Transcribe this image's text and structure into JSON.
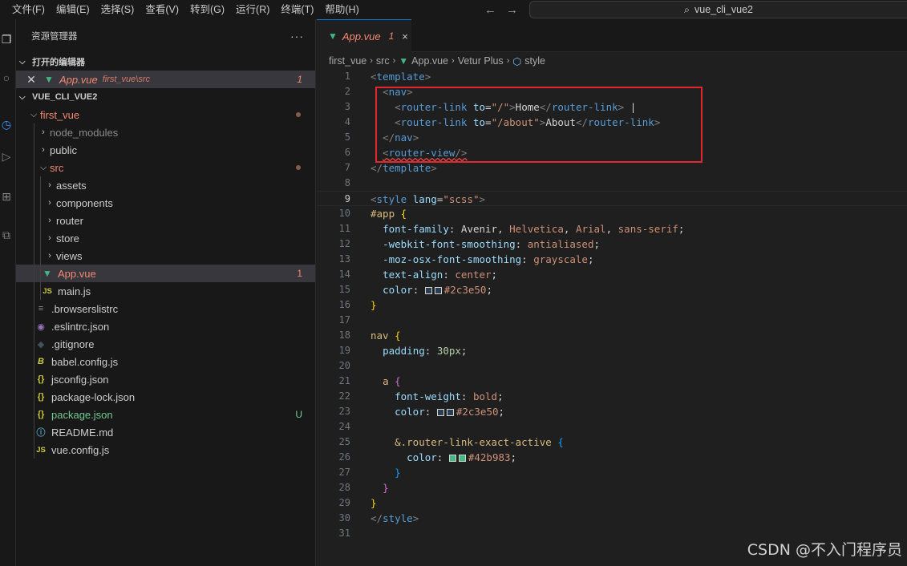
{
  "menu": [
    "文件(F)",
    "编辑(E)",
    "选择(S)",
    "查看(V)",
    "转到(G)",
    "运行(R)",
    "终端(T)",
    "帮助(H)"
  ],
  "search": {
    "text": "vue_cli_vue2"
  },
  "sidebar": {
    "title": "资源管理器",
    "open_editors_title": "打开的编辑器",
    "open_editor": {
      "name": "App.vue",
      "path": "first_vue\\src",
      "problems": "1"
    },
    "project_title": "VUE_CLI_VUE2",
    "tree": [
      {
        "label": "first_vue",
        "status": "modified-dot"
      },
      {
        "label": "node_modules"
      },
      {
        "label": "public"
      },
      {
        "label": "src",
        "status": "modified-dot"
      },
      {
        "label": "assets"
      },
      {
        "label": "components"
      },
      {
        "label": "router"
      },
      {
        "label": "store"
      },
      {
        "label": "views"
      },
      {
        "label": "App.vue",
        "badge": "1"
      },
      {
        "label": "main.js"
      },
      {
        "label": ".browserslistrc"
      },
      {
        "label": ".eslintrc.json"
      },
      {
        "label": ".gitignore"
      },
      {
        "label": "babel.config.js"
      },
      {
        "label": "jsconfig.json"
      },
      {
        "label": "package-lock.json"
      },
      {
        "label": "package.json",
        "badge": "U"
      },
      {
        "label": "README.md"
      },
      {
        "label": "vue.config.js"
      }
    ]
  },
  "tab": {
    "name": "App.vue",
    "problems": "1",
    "close": "×"
  },
  "breadcrumb": [
    "first_vue",
    "src",
    "App.vue",
    "Vetur Plus",
    "style"
  ],
  "code": {
    "line_numbers": [
      "1",
      "2",
      "3",
      "4",
      "5",
      "6",
      "7",
      "8",
      "9",
      "10",
      "11",
      "12",
      "13",
      "14",
      "15",
      "16",
      "17",
      "18",
      "19",
      "20",
      "21",
      "22",
      "23",
      "24",
      "25",
      "26",
      "27",
      "28",
      "29",
      "30",
      "31"
    ],
    "active_line": "9",
    "colors": [
      "#2c3e50",
      "#2c3e50",
      "#42b983"
    ]
  },
  "watermark": "CSDN @不入门程序员",
  "colors": {
    "accent": "#0078d4",
    "vue": "#41b883",
    "highlight_box": "#e0282e",
    "error": "#f48771"
  }
}
